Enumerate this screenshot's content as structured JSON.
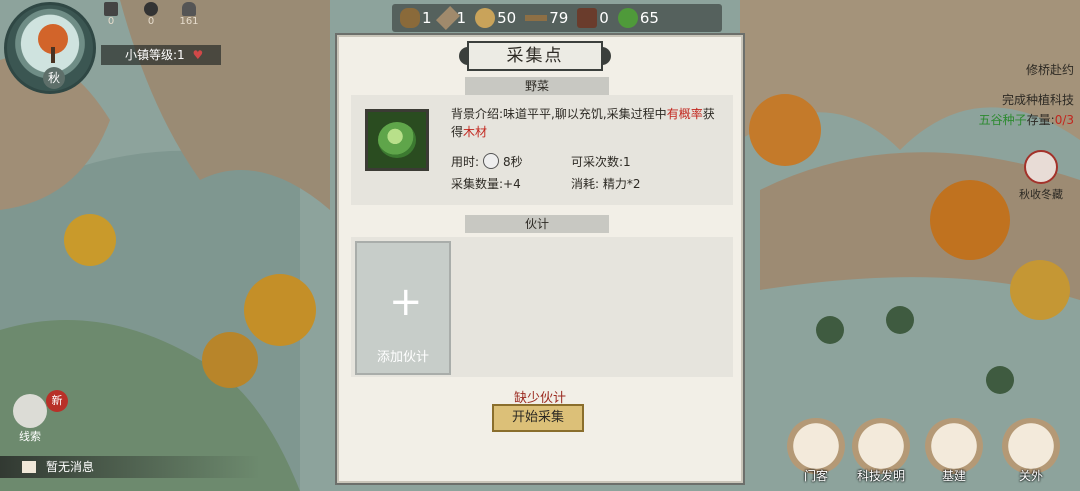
{
  "hud": {
    "season_label": "秋",
    "small_resources": [
      "0",
      "0",
      "161"
    ],
    "town_label": "小镇等级:1",
    "resources": [
      {
        "icon": "wood-log-icon",
        "value": "1"
      },
      {
        "icon": "tool-icon",
        "value": "1"
      },
      {
        "icon": "herb-icon",
        "value": "50"
      },
      {
        "icon": "branch-icon",
        "value": "79"
      },
      {
        "icon": "ore-icon",
        "value": "0"
      },
      {
        "icon": "cabbage-icon",
        "value": "65"
      }
    ]
  },
  "quest": {
    "title": "修桥赴约",
    "line1": "完成种植科技",
    "line2_green": "五谷种子",
    "line2_text": "存量:",
    "line2_red": "0/3"
  },
  "autumn_button": "秋收冬藏",
  "xiansuo": {
    "label": "线索",
    "badge": "新"
  },
  "message": "暂无消息",
  "nav": [
    {
      "label": "门客",
      "icon": "scroll-icon"
    },
    {
      "label": "科技发明",
      "icon": "invention-icon"
    },
    {
      "label": "基建",
      "icon": "building-icon"
    },
    {
      "label": "关外",
      "icon": "sunset-icon"
    }
  ],
  "dialog": {
    "title": "采集点",
    "section1": "野菜",
    "desc_prefix": "背景介绍:味道平平,聊以充饥,采集过程中",
    "desc_red1": "有概率",
    "desc_mid": "获得",
    "desc_red2": "木材",
    "time_label": "用时:",
    "time_value": "8秒",
    "times_label": "可采次数:1",
    "count_label": "采集数量:+4",
    "cost_label": "消耗:",
    "cost_value": "精力*2",
    "section2": "伙计",
    "add_partner": "添加伙计",
    "lack": "缺少伙计",
    "start": "开始采集"
  }
}
